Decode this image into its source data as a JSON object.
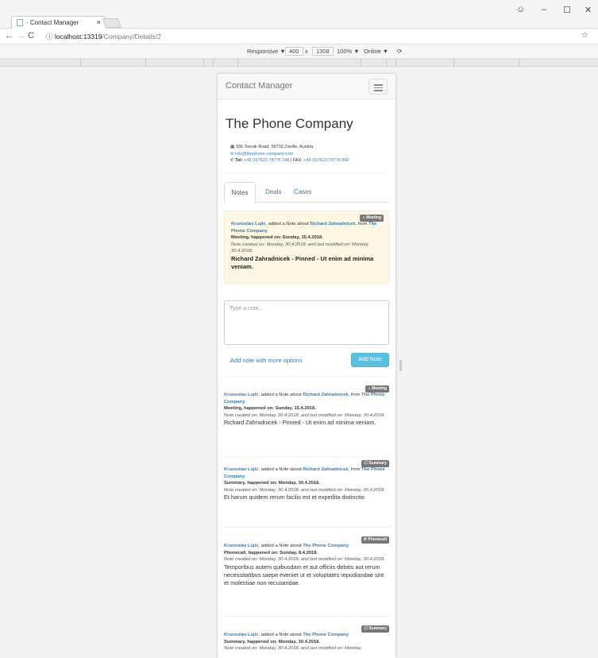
{
  "browser": {
    "tab_title": "- Contact Manager",
    "tab_close": "×",
    "url_host": "localhost:13319",
    "url_path": "/Company/Details/2",
    "window_min": "–",
    "window_max": "☐",
    "window_close": "✕"
  },
  "devtools": {
    "device": "Responsive ▼",
    "width": "400",
    "times": "x",
    "height": "1308",
    "zoom": "100% ▼",
    "network": "Online ▼"
  },
  "app": {
    "brand": "Contact Manager",
    "company_name": "The Phone Company",
    "address": "336 Toorak Road, 56732 Zwolle, Austria",
    "email": "info@thephone-company.com",
    "tel_label": "Tel:",
    "tel": "+49 (0)7623 78776 248",
    "fax_label": "| FAX:",
    "fax": "+49 (0)7623 79776 842"
  },
  "tabs": [
    "Notes",
    "Deals",
    "Cases"
  ],
  "pinned_note": {
    "badge": "Meeting",
    "author": "Krunoslav Lujić",
    "added_text": ", added a Note about ",
    "person": "Richard Zahradnicek",
    "from_text": ", from ",
    "company": "The Phone Company",
    "happened": "Meeting, happened on: Sunday, 15.4.2018.",
    "created": "Note created on: Monday, 30.4.2018. and last modified on: Monday, 30.4.2018.",
    "text": "Richard Zahradnicek - Pinned - Ut enim ad minima veniam."
  },
  "form": {
    "placeholder": "Type a note...",
    "more_options": "Add note with more options",
    "add_button": "Add Note"
  },
  "notes": [
    {
      "badge": "Meeting",
      "author": "Krunoslav Lujić",
      "added_text": ", added a Note about ",
      "person": "Richard Zahradnicek",
      "from_text": ", from ",
      "company": "The Phone Company",
      "happened": "Meeting, happened on: Sunday, 15.4.2018.",
      "created": "Note created on: Monday, 30.4.2018. and last modified on: Monday, 30.4.2018.",
      "text": "Richard Zahradnicek - Pinned - Ut enim ad minima veniam."
    },
    {
      "badge": "Summary",
      "author": "Krunoslav Lujić",
      "added_text": ", added a Note about ",
      "person": "Richard Zahradnicek",
      "from_text": ", from ",
      "company": "The Phone Company",
      "happened": "Summary, happened on: Monday, 30.4.2018.",
      "created": "Note created on: Monday, 30.4.2018. and last modified on: Monday, 30.4.2018.",
      "text": "Et harum quidem rerum facilis est et expedita distinctio"
    },
    {
      "badge": "Phonecall",
      "author": "Krunoslav Lujić",
      "added_text": ", added a Note about ",
      "company": "The Phone Company",
      "happened": "Phonecall, happened on: Sunday, 8.4.2018.",
      "created": "Note created on: Monday, 30.4.2018. and last modified on: Monday, 30.4.2018.",
      "text": "Temporibus autem quibusdam et aut officiis debitis aut rerum necessitatibus saepe eveniet ut et voluptates repudiandae sint et molestiae non recusandae."
    },
    {
      "badge": "Summary",
      "author": "Krunoslav Lujić",
      "added_text": ", added a Note about ",
      "company": "The Phone Company",
      "happened": "Summary, happened on: Monday, 30.4.2018.",
      "created": "Note created on: Monday, 30.4.2018. and last modified on: Monday,"
    }
  ]
}
